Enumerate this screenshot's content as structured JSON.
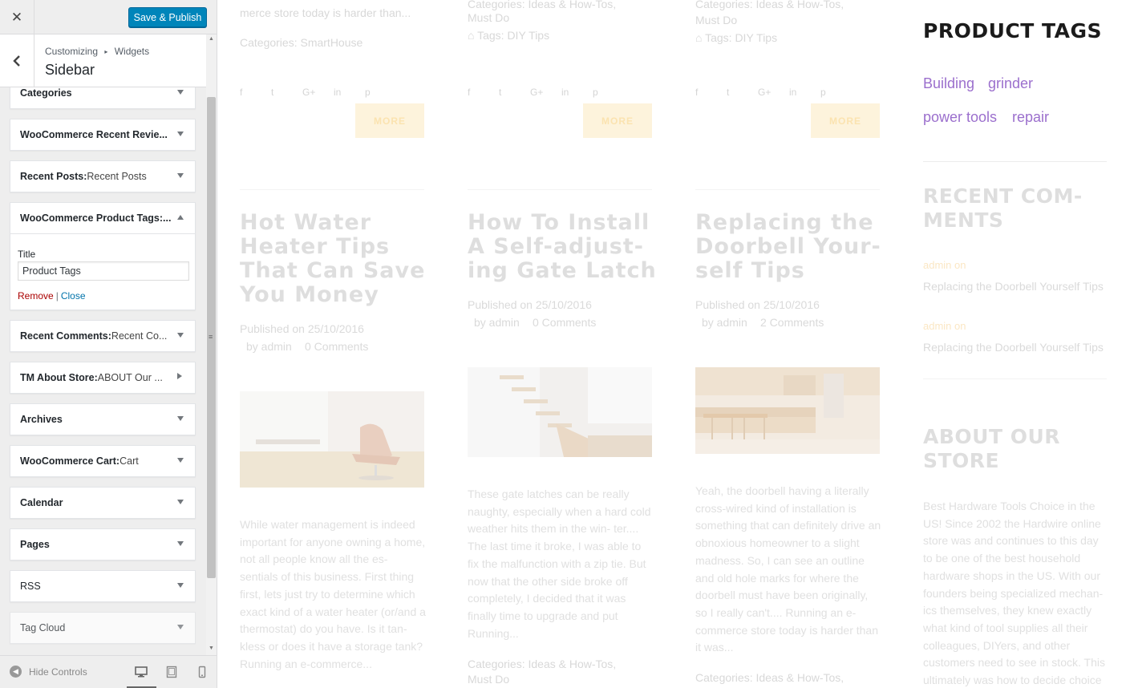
{
  "customizer": {
    "close_icon": "✕",
    "publish_label": "Save & Publish",
    "breadcrumb": [
      "Customizing",
      "Widgets"
    ],
    "breadcrumb_sep": "▸",
    "section_title": "Sidebar",
    "widgets": [
      {
        "name": "Categories",
        "title": ""
      },
      {
        "name": "WooCommerce Recent Revie...",
        "title": ""
      },
      {
        "name": "Recent Posts:",
        "title": " Recent Posts"
      },
      {
        "name": "WooCommerce Product Tags:...",
        "title": "",
        "expanded": true
      },
      {
        "name": "Recent Comments:",
        "title": " Recent Co..."
      },
      {
        "name": "TM About Store:",
        "title": " ABOUT Our ..."
      },
      {
        "name": "Archives",
        "title": ""
      },
      {
        "name": "WooCommerce Cart:",
        "title": " Cart"
      },
      {
        "name": "Calendar",
        "title": ""
      },
      {
        "name": "Pages",
        "title": ""
      },
      {
        "name": "RSS",
        "title": ""
      },
      {
        "name": "Tag Cloud",
        "title": ""
      }
    ],
    "expanded_form": {
      "title_label": "Title",
      "title_value": "Product Tags",
      "remove_label": "Remove",
      "separator": "|",
      "close_label": "Close"
    },
    "hide_controls_label": "Hide Controls",
    "devices": [
      "desktop-icon",
      "tablet-icon",
      "mobile-icon"
    ]
  },
  "preview": {
    "top_snippets": {
      "col1_text": "merce store today is harder than...",
      "col1_categories": "Categories: SmartHouse",
      "col2_categories": "Categories: Ideas & How-Tos,",
      "col2_categories_2": "Must Do",
      "col2_tags": "Tags: DIY Tips",
      "col3_categories": "Categories: Ideas & How-Tos,",
      "col3_categories_2": "Must Do",
      "col3_tags": "Tags: DIY Tips"
    },
    "social_icons": [
      "f",
      "t",
      "G+",
      "in",
      "p"
    ],
    "more_label": "MORE",
    "posts": [
      {
        "title": "Hot Water Heater Tips That Can Save You Money",
        "published": "Published on 25/10/2016",
        "author": "by admin",
        "comments": "0 Comments",
        "excerpt": "While water management is indeed important for anyone owning a home, not all people know all the es- sentials of this business. First thing first, lets just try to determine which exact kind of a water heater (or/and a thermostat) do you have. Is it tan- kless or does it have a storage tank? Running an e-commerce..."
      },
      {
        "title": "How To Install A Self-adjust- ing Gate Latch",
        "published": "Published on 25/10/2016",
        "author": "by admin",
        "comments": "0 Comments",
        "excerpt": "These gate latches can be really naughty, especially when a hard cold weather hits them in the win- ter.... The last time it broke, I was able to fix the malfunction with a zip tie. But now that the other side broke off completely, I decided that it was finally time to upgrade and put Running...",
        "categories": "Categories: Ideas & How-Tos,",
        "categories_2": "Must Do"
      },
      {
        "title": "Replacing the Doorbell Your- self Tips",
        "published": "Published on 25/10/2016",
        "author": "by admin",
        "comments": "2 Comments",
        "excerpt": "Yeah, the doorbell having a literally cross-wired kind of installation is something that can definitely drive an obnoxious homeowner to a slight madness. So, I can see an outline and old hole marks for where the doorbell must have been originally, so I really can't.... Running an e-commerce store today is harder than it was...",
        "categories": "Categories: Ideas & How-Tos,"
      }
    ],
    "sidebar": {
      "title": "PRODUCT TAGS",
      "tags": [
        "Building",
        "grinder",
        "power tools",
        "repair"
      ],
      "recent_comments_title": "RECENT COM- MENTS",
      "recent_comments": [
        {
          "author": "admin on",
          "link": "Replacing the Doorbell Yourself Tips"
        },
        {
          "author": "admin on",
          "link": "Replacing the Doorbell Yourself Tips"
        }
      ],
      "about_title": "ABOUT OUR STORE",
      "about_text": "Best Hardware Tools Choice in the US! Since 2002 the Hardwire online store was and continues to this day to be one of the best household hardware shops in the US. With our founders being specialized mechan- ics themselves, they knew exactly what kind of tool supplies all their colleagues, DIYers, and other customers need to see in stock. This ultimately was how to decide choice of the store..."
    },
    "colors": {
      "accent": "#9b6fcd",
      "publish": "#0085ba",
      "more_bg": "#fdf3dc"
    }
  }
}
